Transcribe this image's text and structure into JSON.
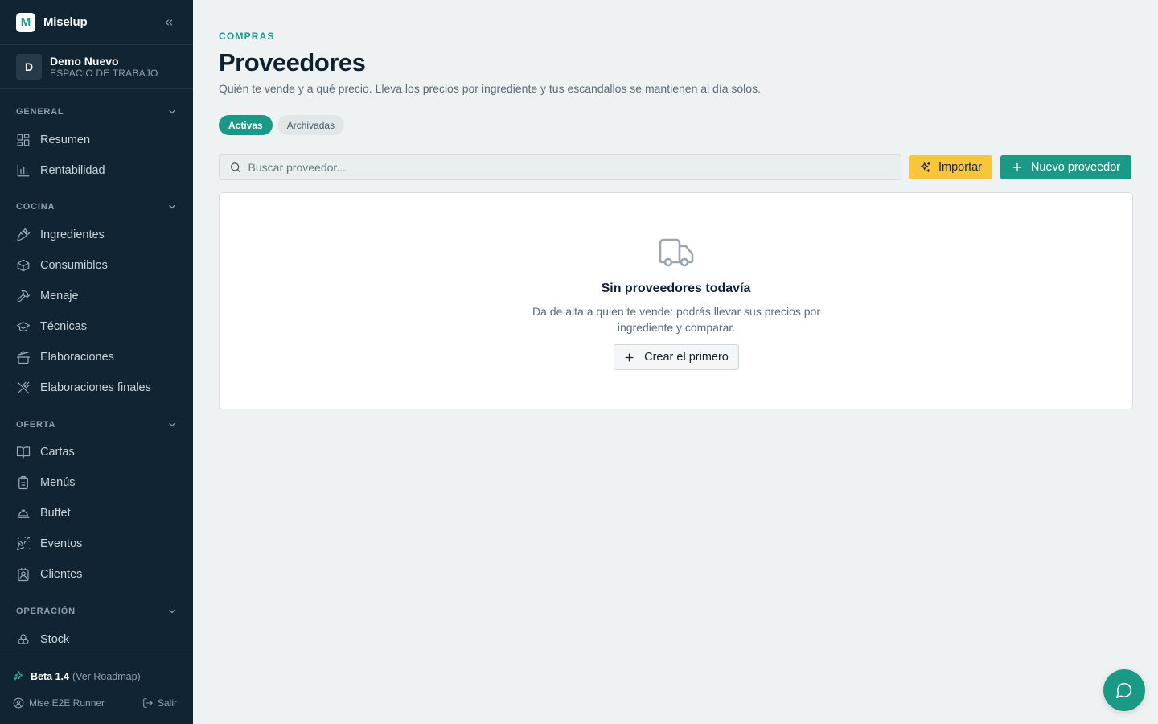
{
  "sidebar": {
    "brand": {
      "logo_letter": "M",
      "name": "Miselup"
    },
    "workspace": {
      "initial": "D",
      "name": "Demo Nuevo",
      "subtitle": "ESPACIO DE TRABAJO"
    },
    "sections": {
      "general": {
        "label": "GENERAL",
        "items": [
          {
            "label": "Resumen",
            "icon": "dashboard-icon"
          },
          {
            "label": "Rentabilidad",
            "icon": "bar-chart-icon"
          }
        ]
      },
      "cocina": {
        "label": "COCINA",
        "items": [
          {
            "label": "Ingredientes",
            "icon": "carrot-icon"
          },
          {
            "label": "Consumibles",
            "icon": "box-icon"
          },
          {
            "label": "Menaje",
            "icon": "hammer-icon"
          },
          {
            "label": "Técnicas",
            "icon": "graduation-cap-icon"
          },
          {
            "label": "Elaboraciones",
            "icon": "cooking-pot-icon"
          },
          {
            "label": "Elaboraciones finales",
            "icon": "utensils-icon"
          }
        ]
      },
      "oferta": {
        "label": "OFERTA",
        "items": [
          {
            "label": "Cartas",
            "icon": "book-open-icon"
          },
          {
            "label": "Menús",
            "icon": "clipboard-icon"
          },
          {
            "label": "Buffet",
            "icon": "cloche-icon"
          },
          {
            "label": "Eventos",
            "icon": "party-popper-icon"
          },
          {
            "label": "Clientes",
            "icon": "contact-icon"
          }
        ]
      },
      "operacion": {
        "label": "OPERACIÓN",
        "items": [
          {
            "label": "Stock",
            "icon": "stock-icon"
          }
        ]
      }
    },
    "footer": {
      "beta_label": "Beta 1.4",
      "roadmap_link": "(Ver Roadmap)",
      "user_name": "Mise E2E Runner",
      "logout_label": "Salir"
    }
  },
  "main": {
    "eyebrow": "COMPRAS",
    "title": "Proveedores",
    "description": "Quién te vende y a qué precio. Lleva los precios por ingrediente y tus escandallos se mantienen al día solos.",
    "tabs": [
      {
        "label": "Activas",
        "active": true
      },
      {
        "label": "Archivadas",
        "active": false
      }
    ],
    "search": {
      "placeholder": "Buscar proveedor..."
    },
    "import_button": "Importar",
    "new_button": "Nuevo proveedor",
    "empty_state": {
      "icon": "truck-icon",
      "title": "Sin proveedores todavía",
      "description": "Da de alta a quien te vende: podrás llevar sus precios por ingrediente y comparar.",
      "button": "Crear el primero"
    }
  },
  "colors": {
    "sidebar_bg": "#102433",
    "accent": "#1a9a86",
    "import_yellow": "#f7c63c",
    "page_bg": "#eef2f2"
  }
}
